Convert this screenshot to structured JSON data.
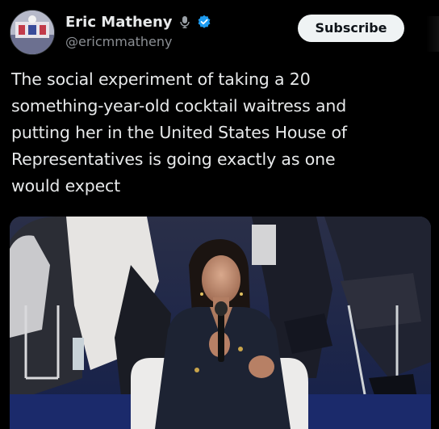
{
  "post": {
    "author": {
      "display_name": "Eric Matheny",
      "handle": "@ericmmatheny",
      "badges": [
        "microphone-icon",
        "verified-icon"
      ],
      "verified_color": "#1d9bf0"
    },
    "subscribe_label": "Subscribe",
    "text": "The social experiment of taking a 20\nsomething-year-old cocktail waitress and\nputting her in the United States House of\nRepresentatives is going exactly as one\nwould expect",
    "media": {
      "type": "photo"
    }
  },
  "colors": {
    "background": "#000000",
    "text_primary": "#e7e9ea",
    "text_secondary": "#8b8f94",
    "button_bg": "#eff3f4",
    "button_text": "#0f1419"
  }
}
